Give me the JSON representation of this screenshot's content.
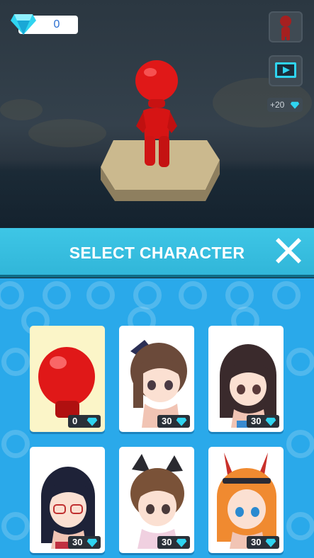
{
  "hud": {
    "gems": "0",
    "reward_label": "+20"
  },
  "panel": {
    "title": "SELECT CHARACTER"
  },
  "characters": [
    {
      "id": "red-stickman",
      "price": "0"
    },
    {
      "id": "girl-brown-hair-ribbon",
      "price": "30"
    },
    {
      "id": "girl-long-dark-hair",
      "price": "30"
    },
    {
      "id": "girl-glasses",
      "price": "30"
    },
    {
      "id": "girl-cat-ears",
      "price": "30"
    },
    {
      "id": "girl-bunny-ears",
      "price": "30"
    }
  ],
  "colors": {
    "banner": "#3ec6e6",
    "background": "#2aa9ea",
    "gem": "#2fd4f0",
    "character": "#e01818"
  },
  "icons": [
    "diamond-icon",
    "character-icon",
    "video-icon",
    "close-icon"
  ]
}
